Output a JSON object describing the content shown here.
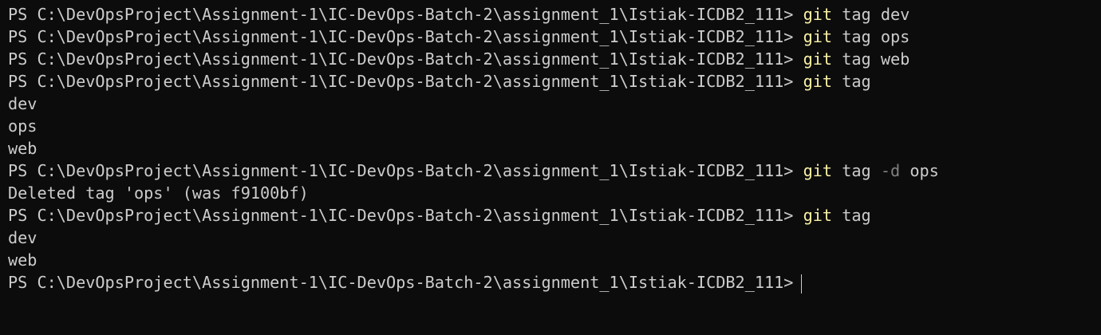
{
  "prompt": "PS C:\\DevOpsProject\\Assignment-1\\IC-DevOps-Batch-2\\assignment_1\\Istiak-ICDB2_111>",
  "command_word": "git",
  "lines": {
    "l1_args": "tag dev",
    "l2_args": "tag ops",
    "l3_args": "tag web",
    "l4_args": "tag",
    "l5_output": "dev",
    "l6_output": "ops",
    "l7_output": "web",
    "l8_args_a": "tag",
    "l8_flag": "-d",
    "l8_args_b": "ops",
    "l9_output": "Deleted tag 'ops' (was f9100bf)",
    "l10_args": "tag",
    "l11_output": "dev",
    "l12_output": "web"
  },
  "colors": {
    "background": "#0c0c0c",
    "text": "#cccccc",
    "command": "#f9f1a5",
    "flag": "#808080"
  }
}
